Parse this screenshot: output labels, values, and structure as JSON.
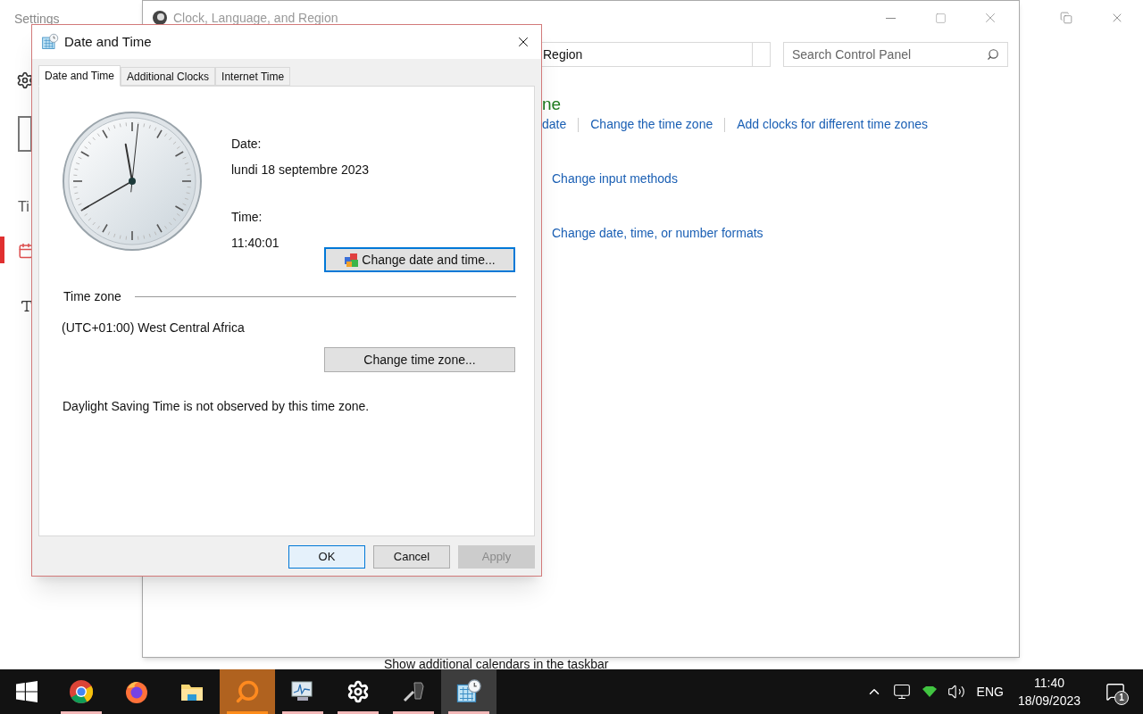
{
  "settings_window": {
    "title": "Settings",
    "nav_text": "Ti",
    "footer_text": "Show additional calendars in the taskbar"
  },
  "control_panel": {
    "title": "Clock, Language, and Region",
    "address": "Region",
    "search": {
      "placeholder": "Search Control Panel"
    },
    "heading": "ne",
    "link_rows": [
      [
        "date",
        "Change the time zone",
        "Add clocks for different time zones"
      ],
      [
        "Change input methods"
      ],
      [
        "Change date, time, or number formats"
      ]
    ]
  },
  "dialog": {
    "title": "Date and Time",
    "tabs": [
      {
        "label": "Date and Time",
        "selected": true
      },
      {
        "label": "Additional Clocks",
        "selected": false
      },
      {
        "label": "Internet Time",
        "selected": false
      }
    ],
    "date_label": "Date:",
    "date": "lundi 18 septembre 2023",
    "time_label": "Time:",
    "time": "11:40:01",
    "change_datetime_button": "Change date and time...",
    "timezone_heading": "Time zone",
    "timezone": "(UTC+01:00) West Central Africa",
    "change_timezone_button": "Change time zone...",
    "dst_note": "Daylight Saving Time is not observed by this time zone.",
    "buttons": [
      {
        "label": "OK",
        "focused": true,
        "disabled": false
      },
      {
        "label": "Cancel",
        "focused": false,
        "disabled": false
      },
      {
        "label": "Apply",
        "focused": false,
        "disabled": true
      }
    ]
  },
  "taskbar": {
    "apps": [
      {
        "kind": "chrome",
        "open": true,
        "selected": false,
        "hovered": false
      },
      {
        "kind": "firefox",
        "open": false,
        "selected": false,
        "hovered": false
      },
      {
        "kind": "folder",
        "open": false,
        "selected": false,
        "hovered": false
      },
      {
        "kind": "search",
        "open": true,
        "selected": true,
        "hovered": false
      },
      {
        "kind": "monitor",
        "open": true,
        "selected": false,
        "hovered": false
      },
      {
        "kind": "gear",
        "open": true,
        "selected": false,
        "hovered": false
      },
      {
        "kind": "tool",
        "open": true,
        "selected": false,
        "hovered": false
      },
      {
        "kind": "calendar",
        "open": true,
        "selected": false,
        "hovered": true
      }
    ],
    "tray": {
      "language": "ENG",
      "time": "11:40",
      "date": "18/09/2023",
      "notifications": "1"
    }
  }
}
